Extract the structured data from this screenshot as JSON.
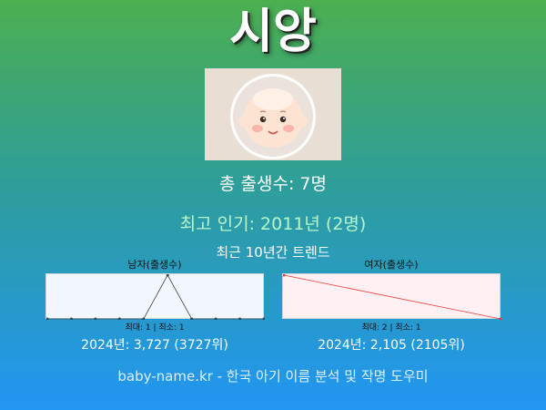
{
  "name": "시앙",
  "total_births": "총 출생수: 7명",
  "most_popular": "최고 인기: 2011년 (2명)",
  "trend_title": "최근 10년간 트렌드",
  "colors": {
    "popular_text": "#b9f6ca",
    "male_bg": "#f3f8ff",
    "female_bg": "#fff0f4",
    "female_line": "#e53935",
    "male_line": "#37474f"
  },
  "male": {
    "label": "남자(출생수)",
    "minmax": "최대: 1 | 최소: 1",
    "year_stat": "2024년: 3,727 (3727위)"
  },
  "female": {
    "label": "여자(출생수)",
    "minmax": "최대: 2 | 최소: 1",
    "year_stat": "2024년: 2,105 (2105위)"
  },
  "chart_data": [
    {
      "type": "line",
      "title": "남자(출생수)",
      "x": [
        0,
        1,
        2,
        3,
        4,
        5,
        6,
        7,
        8,
        9
      ],
      "values": [
        0,
        0,
        0,
        0,
        0,
        1,
        0,
        0,
        0,
        0
      ],
      "ylim": [
        0,
        1
      ]
    },
    {
      "type": "line",
      "title": "여자(출생수)",
      "x": [
        0,
        9
      ],
      "values": [
        2,
        1
      ],
      "ylim": [
        1,
        2
      ]
    }
  ],
  "footer": "baby-name.kr - 한국 아기 이름 분석 및 작명 도우미"
}
